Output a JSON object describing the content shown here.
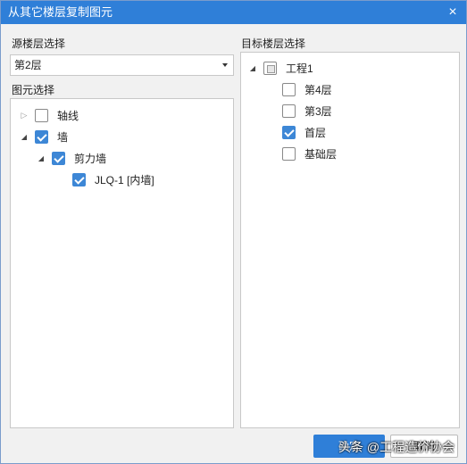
{
  "window": {
    "title": "从其它楼层复制图元",
    "close_glyph": "×"
  },
  "source": {
    "label": "源楼层选择",
    "selected_value": "第2层"
  },
  "elements": {
    "label": "图元选择",
    "tree": {
      "axis": {
        "label": "轴线",
        "checked": false,
        "expanded": false
      },
      "wall": {
        "label": "墙",
        "checked": true,
        "expanded": true
      },
      "shear_wall": {
        "label": "剪力墙",
        "checked": true,
        "expanded": true
      },
      "jlq": {
        "label": "JLQ-1 [内墙]",
        "checked": true
      }
    }
  },
  "target": {
    "label": "目标楼层选择",
    "tree": {
      "project": {
        "label": "工程1",
        "state": "partial",
        "expanded": true
      },
      "floor4": {
        "label": "第4层",
        "checked": false
      },
      "floor3": {
        "label": "第3层",
        "checked": false
      },
      "first": {
        "label": "首层",
        "checked": true
      },
      "base": {
        "label": "基础层",
        "checked": false
      }
    }
  },
  "buttons": {
    "ok_label": "确定",
    "cancel_label": "取消"
  },
  "watermark": "头条 @工程造价协会",
  "colors": {
    "title_bar": "#2f7fd8",
    "accent": "#3d87d6",
    "background": "#f1f1f1"
  },
  "icons": {
    "expanded": "black-triangle-down-right",
    "collapsed": "white-triangle-right",
    "dropdown": "triangle-down"
  }
}
